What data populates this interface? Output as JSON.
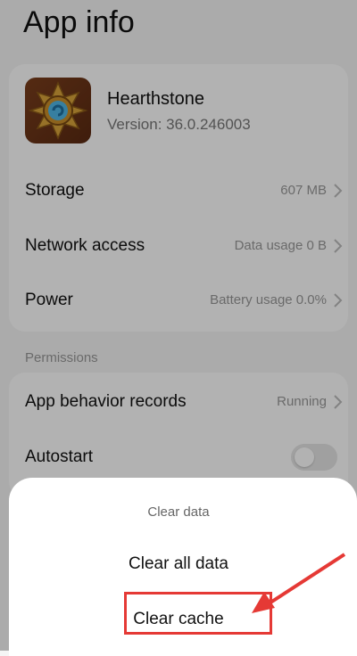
{
  "page": {
    "title": "App info"
  },
  "app": {
    "name": "Hearthstone",
    "version": "Version: 36.0.246003",
    "icon": "hearthstone-app-icon"
  },
  "rows": [
    {
      "label": "Storage",
      "value": "607 MB"
    },
    {
      "label": "Network access",
      "value": "Data usage 0 B"
    },
    {
      "label": "Power",
      "value": "Battery usage 0.0%"
    }
  ],
  "permissions": {
    "section_label": "Permissions",
    "rows": [
      {
        "label": "App behavior records",
        "value": "Running"
      },
      {
        "label": "Autostart",
        "toggle": false
      }
    ]
  },
  "dialog": {
    "title": "Clear data",
    "options": [
      "Clear all data",
      "Clear cache"
    ],
    "highlighted": "Clear cache"
  },
  "colors": {
    "annotation": "#e53935"
  }
}
